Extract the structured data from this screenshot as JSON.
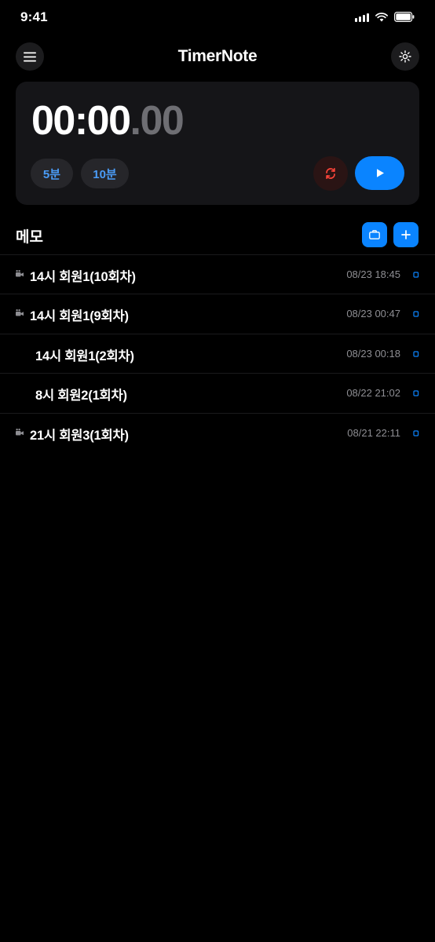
{
  "status_bar": {
    "time": "9:41"
  },
  "header": {
    "title": "TimerNote",
    "left_icon": "menu-icon",
    "right_icon": "gear-icon"
  },
  "timer": {
    "main": "00:00",
    "fraction": ".00",
    "presets": [
      "5분",
      "10분"
    ],
    "reset_icon": "reset-icon",
    "play_icon": "play-icon",
    "colors": {
      "accent": "#0a84ff",
      "reset": "#ff453a"
    }
  },
  "memo": {
    "title": "메모",
    "toolbox_icon": "briefcase-icon",
    "add_icon": "plus-icon",
    "items": [
      {
        "title": "14시 회원1(10회차)",
        "date": "08/23 18:45",
        "icon": "video-camera-icon"
      },
      {
        "title": "14시 회원1(9회차)",
        "date": "08/23 00:47",
        "icon": "video-camera-icon"
      },
      {
        "title": "14시 회원1(2회차)",
        "date": "08/23 00:18",
        "icon": ""
      },
      {
        "title": "8시 회원2(1회차)",
        "date": "08/22 21:02",
        "icon": ""
      },
      {
        "title": "21시 회원3(1회차)",
        "date": "08/21 22:11",
        "icon": "video-camera-icon"
      }
    ]
  }
}
